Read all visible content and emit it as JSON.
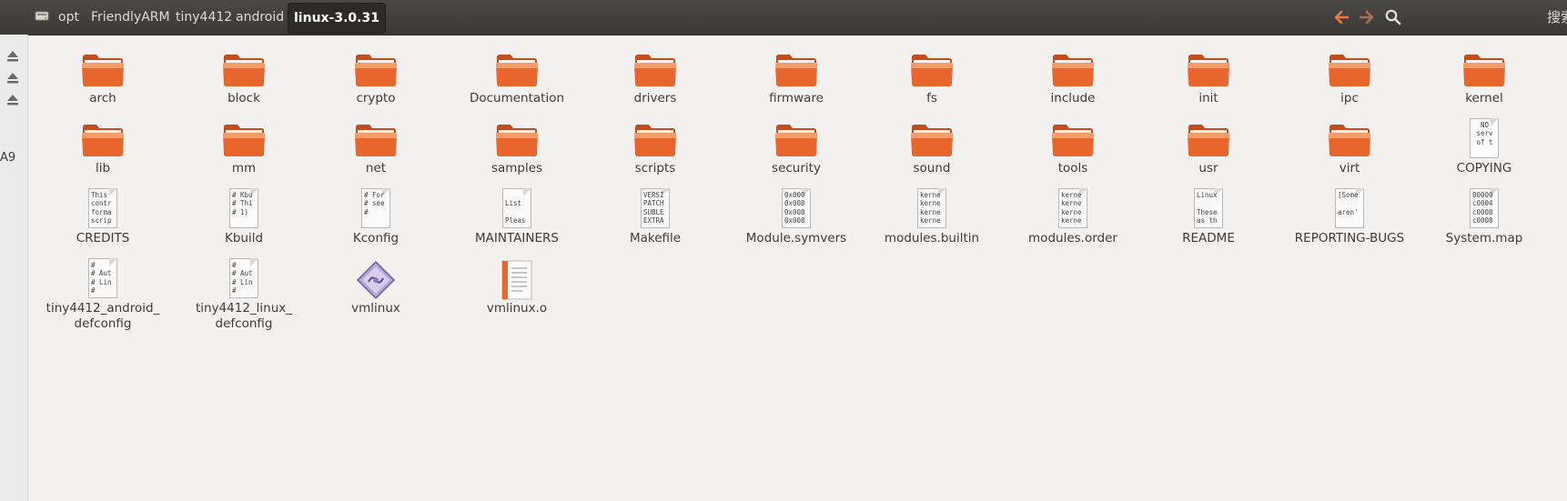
{
  "breadcrumb": {
    "items": [
      "opt",
      "FriendlyARM",
      "tiny4412",
      "android"
    ],
    "current": "linux-3.0.31"
  },
  "toolbar": {
    "back_icon": "back-arrow-icon",
    "forward_icon": "forward-arrow-icon",
    "search_icon": "search-icon",
    "search_label": "搜索"
  },
  "sidebar": {
    "eject_icons": [
      "eject-icon",
      "eject-icon",
      "eject-icon"
    ],
    "partial_label": "A9"
  },
  "colors": {
    "folder": "#e8662c",
    "folder_light": "#f49c6a",
    "accent": "#f07746",
    "topbar": "#3c3b37"
  },
  "files": [
    {
      "name": "arch",
      "type": "folder"
    },
    {
      "name": "block",
      "type": "folder"
    },
    {
      "name": "crypto",
      "type": "folder"
    },
    {
      "name": "Documentation",
      "type": "folder"
    },
    {
      "name": "drivers",
      "type": "folder"
    },
    {
      "name": "firmware",
      "type": "folder"
    },
    {
      "name": "fs",
      "type": "folder"
    },
    {
      "name": "include",
      "type": "folder"
    },
    {
      "name": "init",
      "type": "folder"
    },
    {
      "name": "ipc",
      "type": "folder"
    },
    {
      "name": "kernel",
      "type": "folder"
    },
    {
      "name": "lib",
      "type": "folder"
    },
    {
      "name": "mm",
      "type": "folder"
    },
    {
      "name": "net",
      "type": "folder"
    },
    {
      "name": "samples",
      "type": "folder"
    },
    {
      "name": "scripts",
      "type": "folder"
    },
    {
      "name": "security",
      "type": "folder"
    },
    {
      "name": "sound",
      "type": "folder"
    },
    {
      "name": "tools",
      "type": "folder"
    },
    {
      "name": "usr",
      "type": "folder"
    },
    {
      "name": "virt",
      "type": "folder"
    },
    {
      "name": "COPYING",
      "type": "text",
      "preview": "  NO\n serv\n of t"
    },
    {
      "name": "CREDITS",
      "type": "text",
      "preview": "This\ncontr\nforma\nscrip"
    },
    {
      "name": "Kbuild",
      "type": "text",
      "preview": "# Kbu\n# Thi\n# 1)"
    },
    {
      "name": "Kconfig",
      "type": "text",
      "preview": "# For\n# see\n#"
    },
    {
      "name": "MAINTAINERS",
      "type": "text",
      "preview": "\nList\n\nPleas"
    },
    {
      "name": "Makefile",
      "type": "text",
      "preview": "VERSI\nPATCH\nSUBLE\nEXTRA"
    },
    {
      "name": "Module.symvers",
      "type": "text",
      "preview": "0x000\n0x008\n0x008\n0x008"
    },
    {
      "name": "modules.builtin",
      "type": "text",
      "preview": "kerne\nkerne\nkerne\nkerne"
    },
    {
      "name": "modules.order",
      "type": "text",
      "preview": "kerne\nkerne\nkerne\nkerne"
    },
    {
      "name": "README",
      "type": "text",
      "preview": "Linux\n\nThese\nas th"
    },
    {
      "name": "REPORTING-BUGS",
      "type": "text",
      "preview": "[Some\n\naren'"
    },
    {
      "name": "System.map",
      "type": "text",
      "preview": "00000\nc0004\nc0008\nc0008"
    },
    {
      "name": "tiny4412_android_\ndefconfig",
      "type": "text",
      "preview": "#\n# Aut\n# Lin\n#"
    },
    {
      "name": "tiny4412_linux_\ndefconfig",
      "type": "text",
      "preview": "#\n# Aut\n# Lin\n#"
    },
    {
      "name": "vmlinux",
      "type": "executable"
    },
    {
      "name": "vmlinux.o",
      "type": "object"
    }
  ]
}
